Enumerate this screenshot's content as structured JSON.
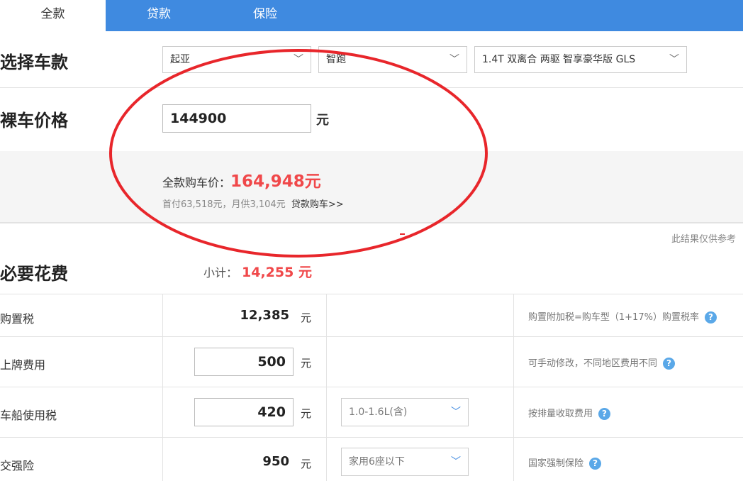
{
  "tabs": [
    {
      "label": "全款",
      "active": true
    },
    {
      "label": "贷款",
      "active": false
    },
    {
      "label": "保险",
      "active": false
    }
  ],
  "select_car": {
    "title": "选择车款",
    "brand": "起亚",
    "series": "智跑",
    "model": "1.4T 双离合 两驱 智享豪华版 GLS"
  },
  "bare_price": {
    "title": "裸车价格",
    "value": "144900",
    "unit": "元"
  },
  "summary": {
    "total_label": "全款购车价：",
    "total_value": "164,948元",
    "sub_text": "首付63,518元，月供3,104元",
    "loan_link": "贷款购车>>"
  },
  "disclaimer": "此结果仅供参考",
  "required": {
    "title": "必要花费",
    "subtotal_label": "小计：",
    "subtotal_value": "14,255 元",
    "rows": [
      {
        "label": "购置税",
        "value": "12,385",
        "unit": "元",
        "note": "购置附加税=购车型（1+17%）购置税率"
      },
      {
        "label": "上牌费用",
        "value": "500",
        "unit": "元",
        "note": "可手动修改，不同地区费用不同"
      },
      {
        "label": "车船使用税",
        "value": "420",
        "unit": "元",
        "option": "1.0-1.6L(含)",
        "note": "按排量收取费用"
      },
      {
        "label": "交强险",
        "value": "950",
        "unit": "元",
        "option": "家用6座以下",
        "note": "国家强制保险"
      }
    ]
  },
  "colors": {
    "tab_bar": "#3f8ae0",
    "price_red": "#f0484a",
    "annotation_ellipse": "#e8262b",
    "help_icon": "#5aa8e8"
  }
}
